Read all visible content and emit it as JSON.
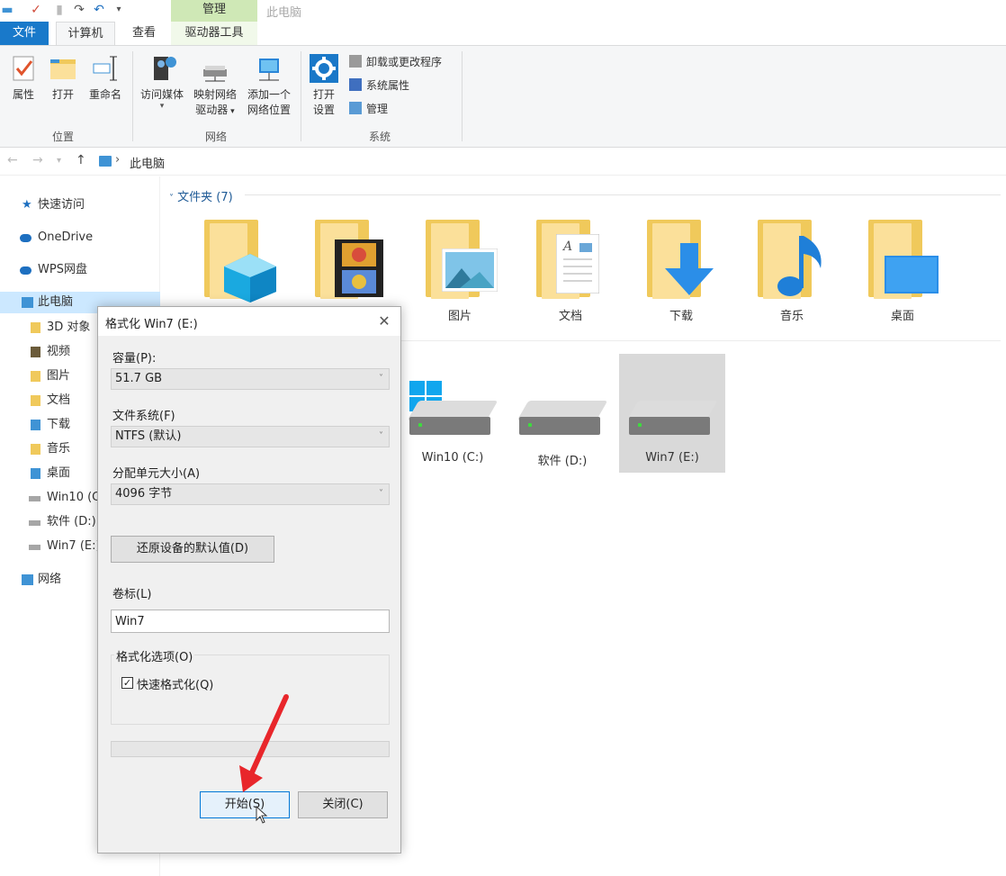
{
  "window": {
    "title": "此电脑",
    "context_tab": "管理"
  },
  "tabs": {
    "file": "文件",
    "computer": "计算机",
    "view": "查看",
    "drive_tools": "驱动器工具"
  },
  "ribbon": {
    "location": {
      "label": "位置",
      "properties": "属性",
      "open": "打开",
      "rename": "重命名"
    },
    "network": {
      "label": "网络",
      "access_media": "访问媒体",
      "map_drive_1": "映射网络",
      "map_drive_2": "驱动器",
      "add_location_1": "添加一个",
      "add_location_2": "网络位置"
    },
    "system": {
      "label": "系统",
      "open_settings_1": "打开",
      "open_settings_2": "设置",
      "uninstall": "卸载或更改程序",
      "system_properties": "系统属性",
      "manage": "管理"
    }
  },
  "address": {
    "path": "此电脑"
  },
  "nav_pane": {
    "items": [
      {
        "label": "快速访问"
      },
      {
        "label": "OneDrive"
      },
      {
        "label": "WPS网盘"
      },
      {
        "label": "此电脑"
      },
      {
        "label": "3D 对象"
      },
      {
        "label": "视频"
      },
      {
        "label": "图片"
      },
      {
        "label": "文档"
      },
      {
        "label": "下载"
      },
      {
        "label": "音乐"
      },
      {
        "label": "桌面"
      },
      {
        "label": "Win10 (C:)"
      },
      {
        "label": "软件 (D:)"
      },
      {
        "label": "Win7 (E:)"
      },
      {
        "label": "网络"
      }
    ]
  },
  "content": {
    "folders_header": "文件夹 (7)",
    "folders": [
      {
        "label": "3D 对象"
      },
      {
        "label": "视频"
      },
      {
        "label": "图片"
      },
      {
        "label": "文档"
      },
      {
        "label": "下载"
      },
      {
        "label": "音乐"
      },
      {
        "label": "桌面"
      }
    ],
    "drives": [
      {
        "label": "Win10 (C:)"
      },
      {
        "label": "软件 (D:)"
      },
      {
        "label": "Win7 (E:)"
      }
    ]
  },
  "dialog": {
    "title": "格式化 Win7 (E:)",
    "capacity_label": "容量(P):",
    "capacity_value": "51.7 GB",
    "filesystem_label": "文件系统(F)",
    "filesystem_value": "NTFS (默认)",
    "alloc_label": "分配单元大小(A)",
    "alloc_value": "4096 字节",
    "restore_button": "还原设备的默认值(D)",
    "volume_label": "卷标(L)",
    "volume_value": "Win7",
    "options_label": "格式化选项(O)",
    "quick_format": "快速格式化(Q)",
    "start_button": "开始(S)",
    "close_button": "关闭(C)"
  },
  "colors": {
    "accent": "#1979ca",
    "context_tab": "#cfe8b6",
    "selected": "#cce8ff",
    "arrow": "#e8262b"
  }
}
